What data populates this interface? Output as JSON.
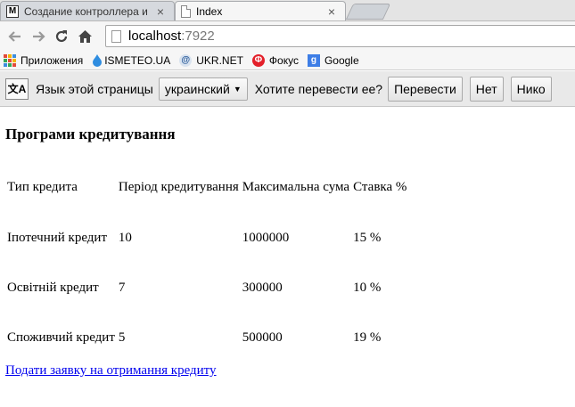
{
  "browser": {
    "tabs": [
      {
        "title": "Создание контроллера и",
        "active": false
      },
      {
        "title": "Index",
        "active": true
      }
    ],
    "close_glyph": "×",
    "omnibox": {
      "host": "localhost",
      "port": ":7922"
    },
    "bookmarks": [
      {
        "label": "Приложения",
        "icon": "apps-grid-icon"
      },
      {
        "label": "",
        "icon": "drop-icon"
      },
      {
        "label": "ISMETEO.UA",
        "icon": "meteo-icon"
      },
      {
        "label": "UKR.NET",
        "icon": "ukrnet-icon"
      },
      {
        "label": "Фокус",
        "icon": "fokus-icon"
      },
      {
        "label": "Google",
        "icon": "google-icon"
      }
    ]
  },
  "translate_bar": {
    "page_language_label": "Язык этой страницы",
    "language_value": "украинский",
    "prompt": "Хотите перевести ее?",
    "translate_button": "Перевести",
    "no_button": "Нет",
    "never_button": "Нико"
  },
  "page": {
    "title": "Програми кредитування",
    "table": {
      "headers": [
        "Тип кредита",
        "Період кредитування",
        "Максимальна сума",
        "Ставка %"
      ],
      "rows": [
        [
          "Іпотечний кредит",
          "10",
          "1000000",
          "15 %"
        ],
        [
          "Освітній кредит",
          "7",
          "300000",
          "10 %"
        ],
        [
          "Споживчий кредит",
          "5",
          "500000",
          "19 %"
        ]
      ]
    },
    "apply_link": "Подати заявку на отримання кредиту"
  },
  "colors": {
    "link": "#0000ee",
    "fokus_red": "#e3202a",
    "google_blue": "#3d7ee6",
    "ukrnet_blue": "#2a5b9a"
  }
}
